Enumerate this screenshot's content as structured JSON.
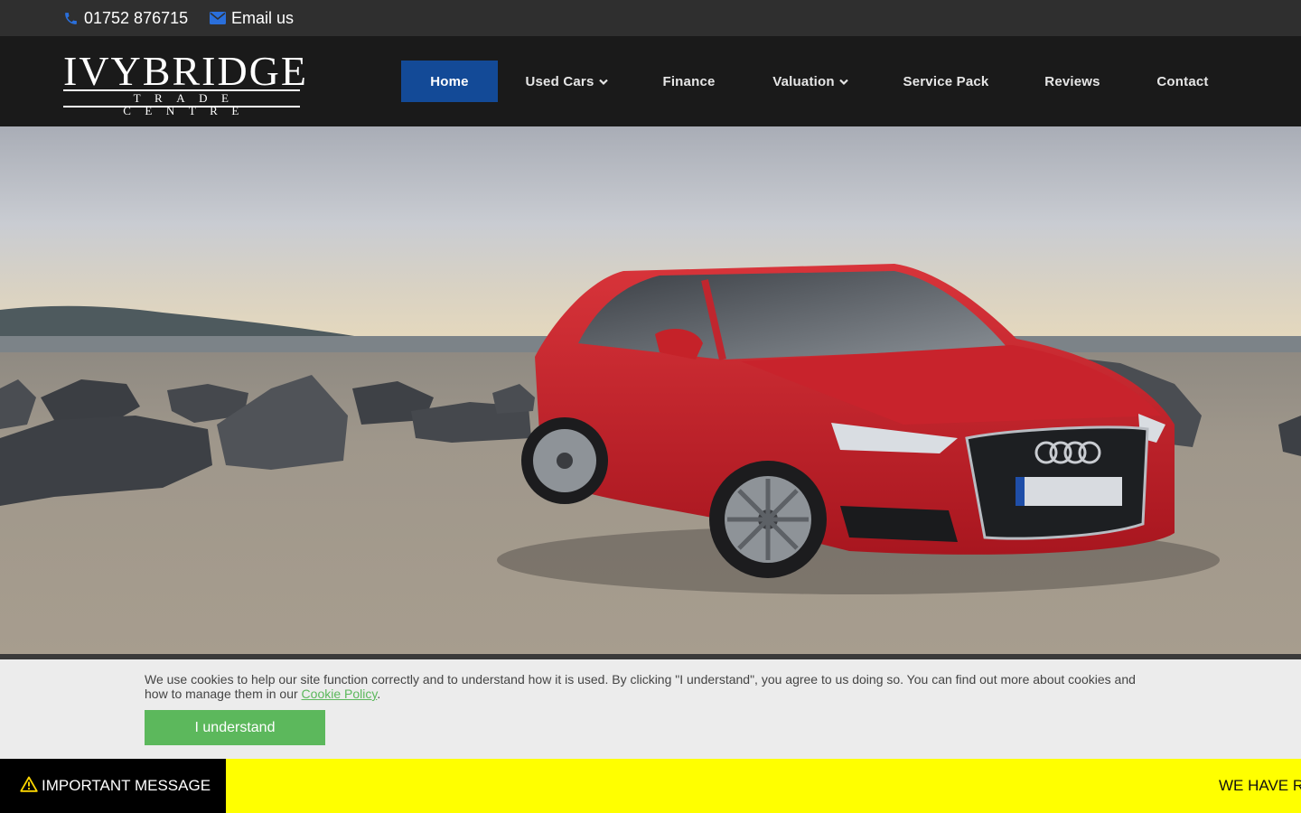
{
  "topbar": {
    "phone": "01752 876715",
    "email": "Email us",
    "icon_color": "#2a6fdb"
  },
  "logo": {
    "main": "IVYBRIDGE",
    "sub": "TRADE CENTRE"
  },
  "nav": {
    "items": [
      {
        "label": "Home",
        "active": true
      },
      {
        "label": "Used Cars",
        "dropdown": true
      },
      {
        "label": "Finance"
      },
      {
        "label": "Valuation",
        "dropdown": true
      },
      {
        "label": "Service Pack"
      },
      {
        "label": "Reviews"
      },
      {
        "label": "Contact"
      }
    ],
    "active_color": "#134a97"
  },
  "cookie": {
    "text": "We use cookies to help our site function correctly and to understand how it is used. By clicking \"I understand\", you agree to us doing so. You can find out more about cookies and how to manage them in our",
    "link": "Cookie Policy",
    "after_link": ".",
    "button": "I understand",
    "button_color": "#5cb85c"
  },
  "message": {
    "label": "IMPORTANT MESSAGE",
    "scroll_text": "WE HAVE R",
    "bar_color": "#ffff00"
  }
}
